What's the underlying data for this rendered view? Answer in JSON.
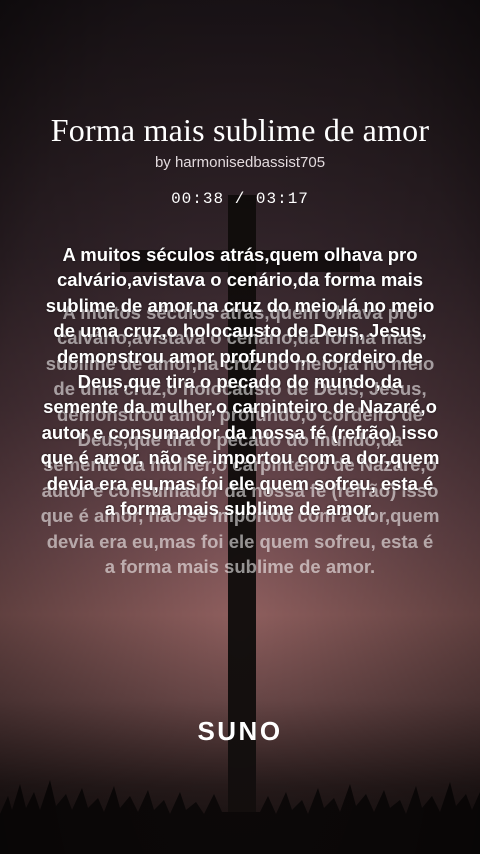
{
  "song": {
    "title": "Forma mais sublime de amor",
    "author": "by harmonisedbassist705",
    "time": "00:38 / 03:17"
  },
  "lyrics": {
    "text": "A muitos séculos atrás,quem olhava pro calvário,avistava o cenário,da forma mais sublime de amor,na cruz do meio,lá no meio de uma cruz,o holocausto de Deus, Jesus, demonstrou amor profundo,o cordeiro de Deus,que tira o pecado do mundo,da semente da mulher,o carpinteiro de Nazaré,o autor e consumador da nossa fé (refrão) isso que é amor, não se importou com a dor,quem devia era eu,mas foi ele quem sofreu, esta é a forma mais sublime de amor."
  },
  "brand": {
    "logo_text": "SUNO"
  },
  "background": {
    "image": "cross-silhouette-sunset",
    "colors": [
      "#231a1f",
      "#5a3e45",
      "#8f5f5e",
      "#15100f"
    ]
  }
}
